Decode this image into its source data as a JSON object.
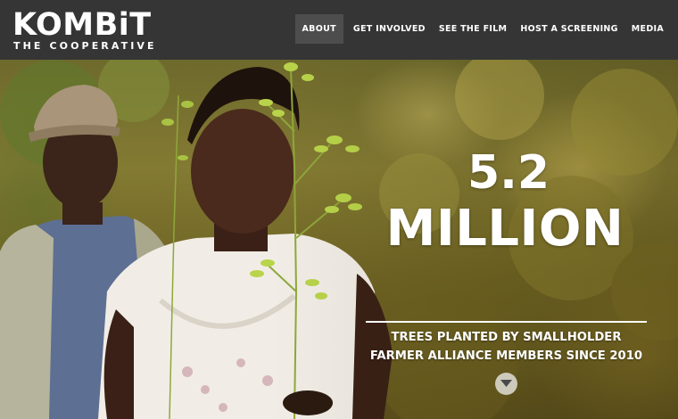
{
  "brand": {
    "name": "KOMBiT",
    "tagline": "THE COOPERATIVE"
  },
  "nav": {
    "items": [
      {
        "label": "ABOUT",
        "active": true
      },
      {
        "label": "GET INVOLVED",
        "active": false
      },
      {
        "label": "SEE THE FILM",
        "active": false
      },
      {
        "label": "HOST A SCREENING",
        "active": false
      },
      {
        "label": "MEDIA",
        "active": false
      }
    ]
  },
  "hero": {
    "stat_number": "5.2",
    "stat_unit": "MILLION",
    "caption_line1": "TREES PLANTED BY SMALLHOLDER",
    "caption_line2": "FARMER ALLIANCE MEMBERS SINCE 2010",
    "scroll_icon": "chevron-down-icon"
  },
  "colors": {
    "navbar_bg": "#353535",
    "nav_active_bg": "#4d4d4d",
    "text": "#ffffff"
  }
}
